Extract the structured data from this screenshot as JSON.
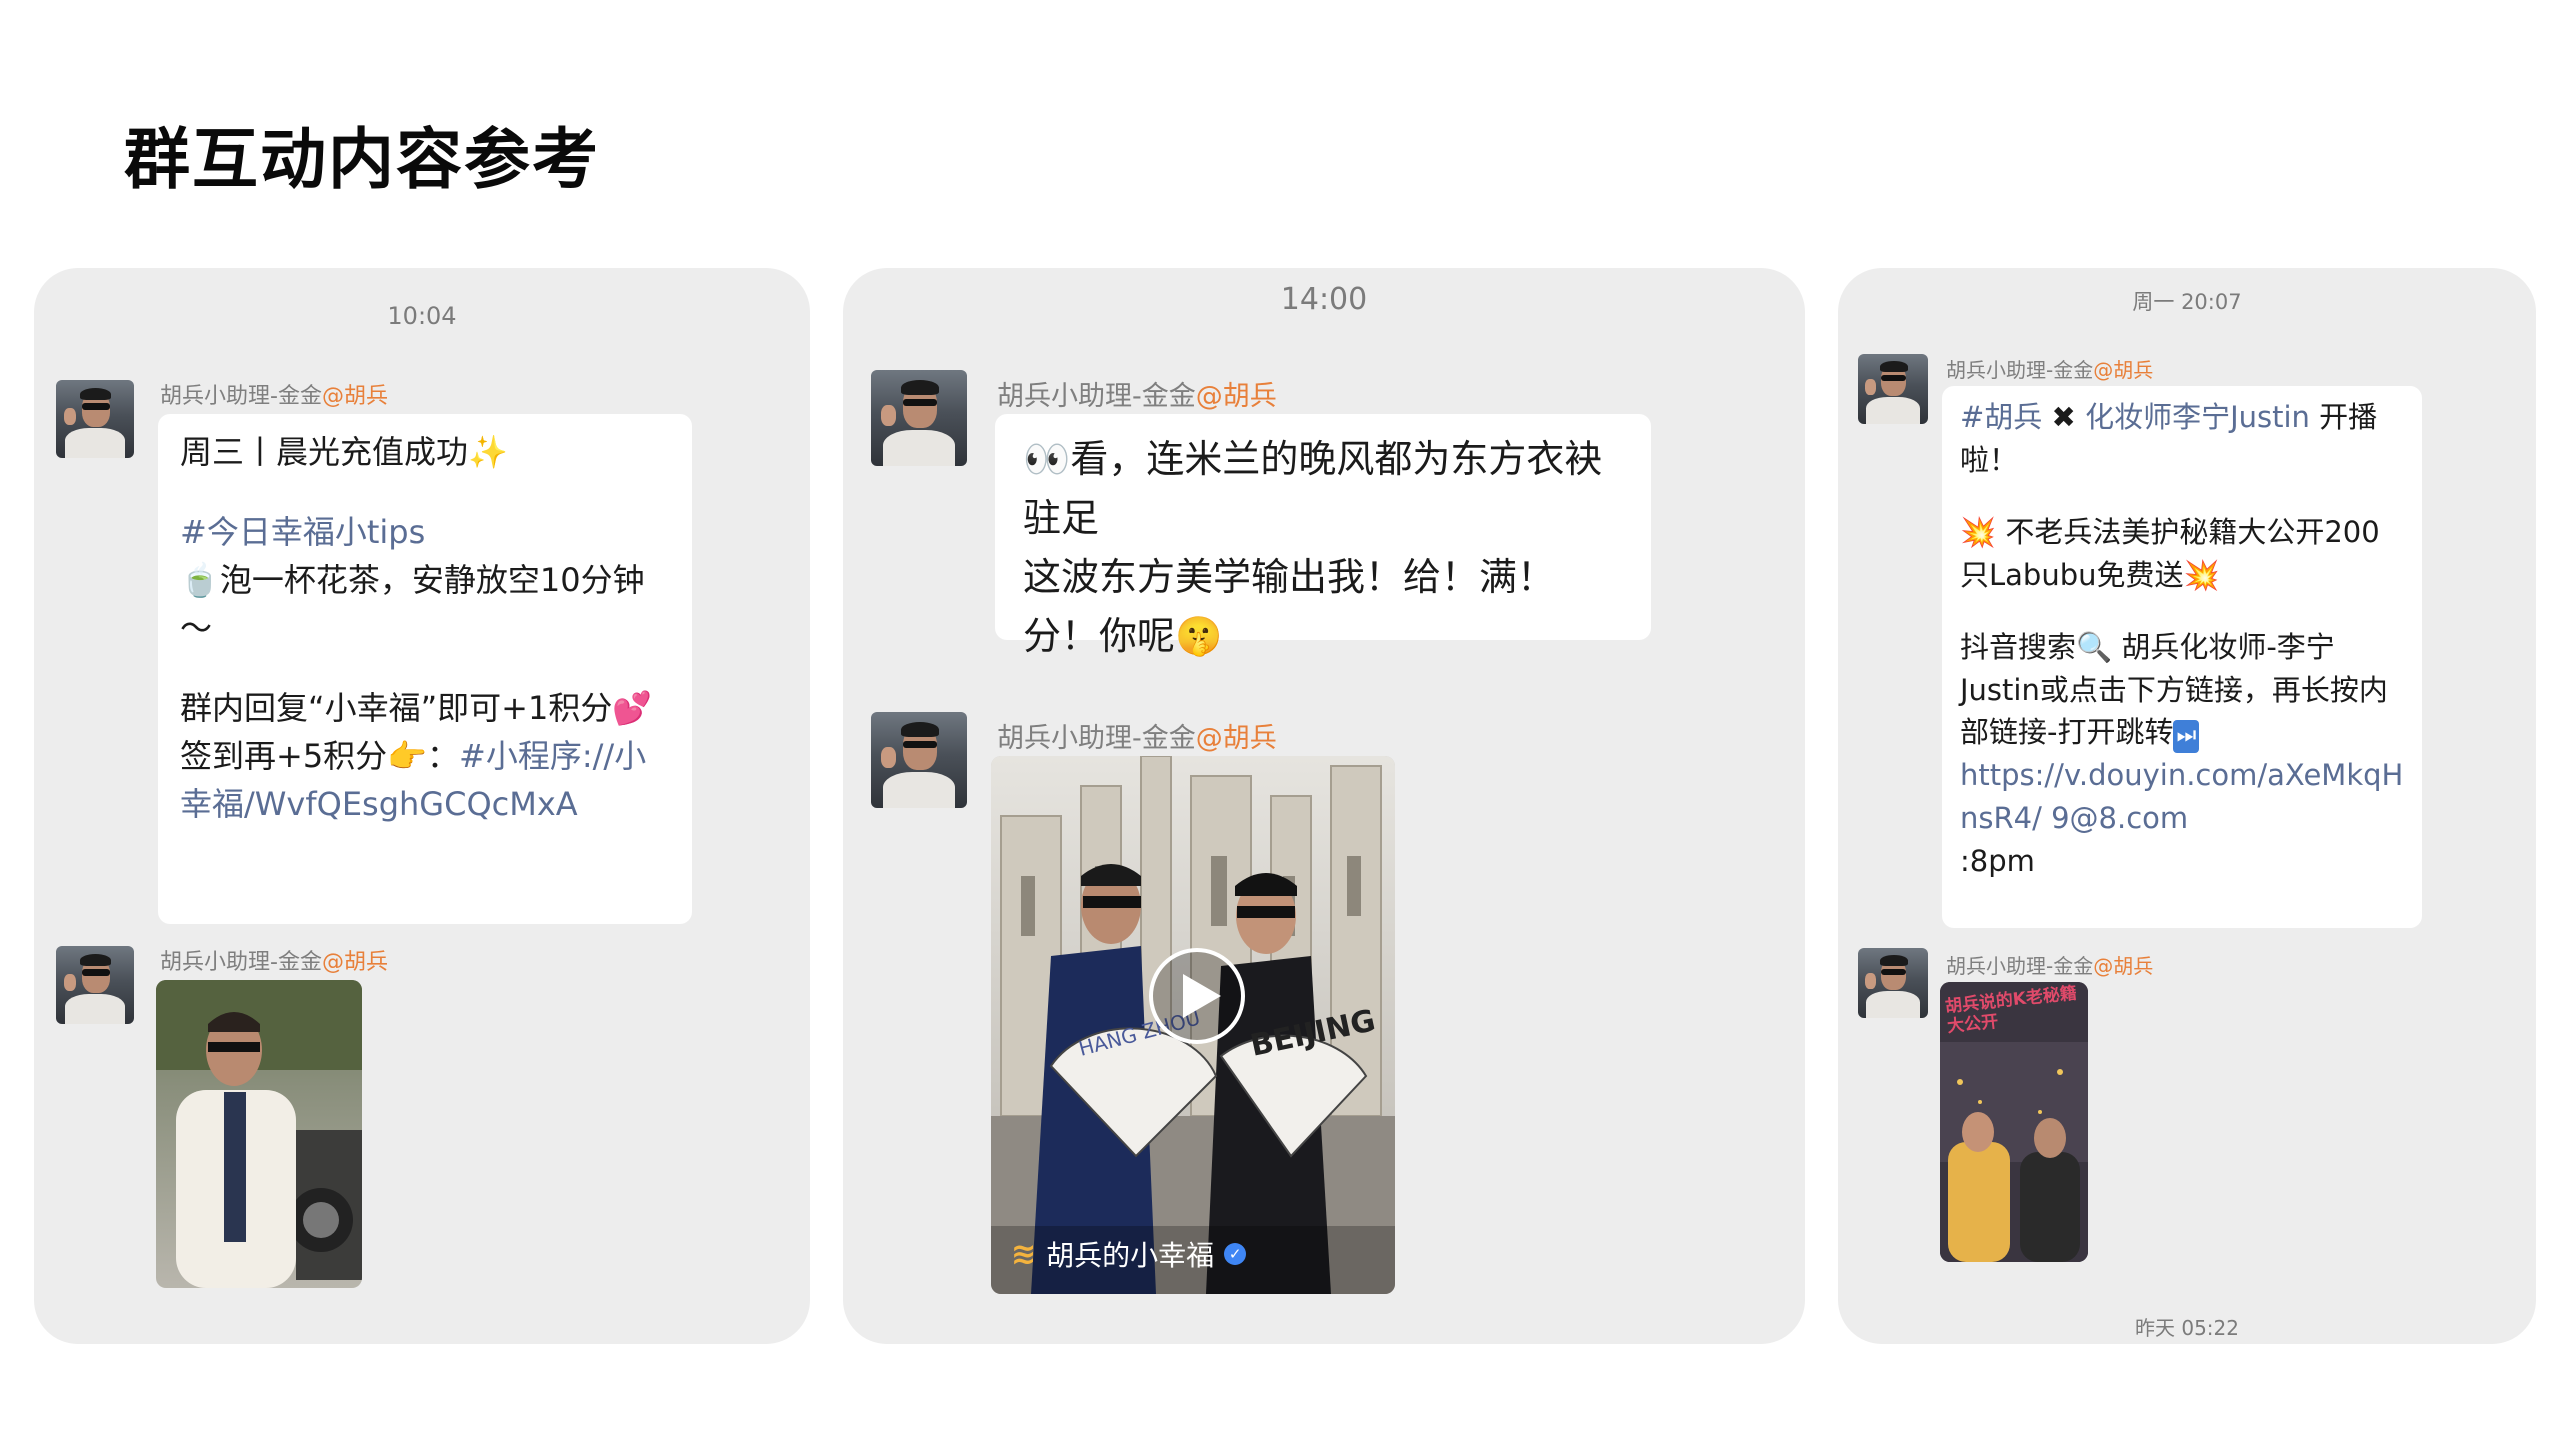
{
  "page": {
    "title": "群互动内容参考"
  },
  "sender": {
    "name": "胡兵小助理-金金",
    "mention": "@胡兵"
  },
  "panel1": {
    "timestamp": "10:04",
    "bubble": {
      "line1": "周三丨晨光充值成功",
      "line1_emoji": "✨",
      "tag": "#今日幸福小tips",
      "tip_emoji": "🍵",
      "tip": "泡一杯花茶，安静放空10分钟～",
      "reply": "群内回复“小幸福”即可+1积分",
      "reply_emoji": "💕",
      "signin": "签到再+5积分",
      "signin_emoji": "👉",
      "colon": "：",
      "link": "#小程序://小幸福/WvfQEsghGCQcMxA"
    }
  },
  "panel2": {
    "timestamp": "14:00",
    "bubble": {
      "emoji1": "👀",
      "line1": "看，连米兰的晚风都为东方衣袂驻足",
      "line2": "这波东方美学输出我！给！满！分！你呢",
      "emoji2": "🤫"
    },
    "video": {
      "channel": "胡兵的小幸福",
      "fan_left_text": "HANG ZHOU",
      "fan_right_text": "BEIJING"
    }
  },
  "panel3": {
    "timestamp_top": "周一 20:07",
    "bubble": {
      "tag1": "#胡兵",
      "cross": "✖",
      "tag2": "化妆师李宁Justin",
      "line1_rest": "开播啦！",
      "boom": "💥",
      "line2": "不老兵法美护秘籍大公开200只Labubu免费送",
      "line3": "抖音搜索",
      "search_emoji": "🔍",
      "line3_rest": "胡兵化妆师-李宁Justin或点击下方链接，再长按内部链接-打开跳转",
      "ff_emoji": "⏭",
      "link": "https://v.douyin.com/aXeMkqHnsR4/ 9@8.com",
      "time": ":8pm"
    },
    "thumb_caption": "胡兵说的K老秘籍大公开",
    "timestamp_bottom": "昨天 05:22"
  },
  "colors": {
    "panel_bg": "#ededed",
    "bubble_bg": "#ffffff",
    "mention": "#e8803a",
    "link": "#5a6d94",
    "meta_text": "#7f7f7f"
  }
}
